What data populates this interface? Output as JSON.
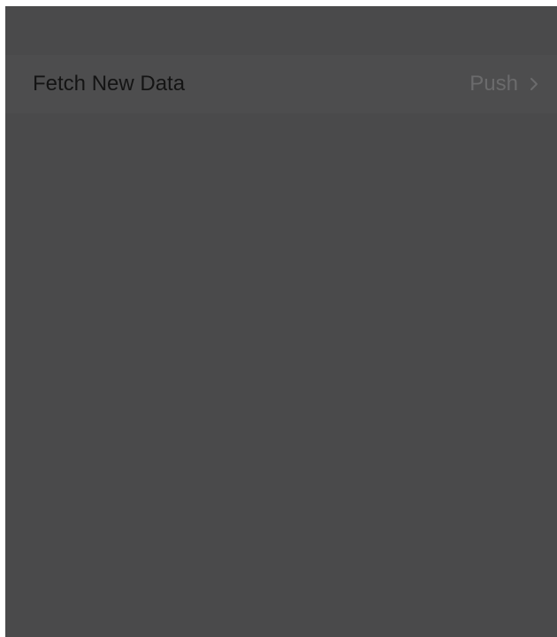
{
  "settings": {
    "row": {
      "label": "Fetch New Data",
      "value": "Push",
      "accessory_icon": "chevron-right-icon"
    }
  }
}
